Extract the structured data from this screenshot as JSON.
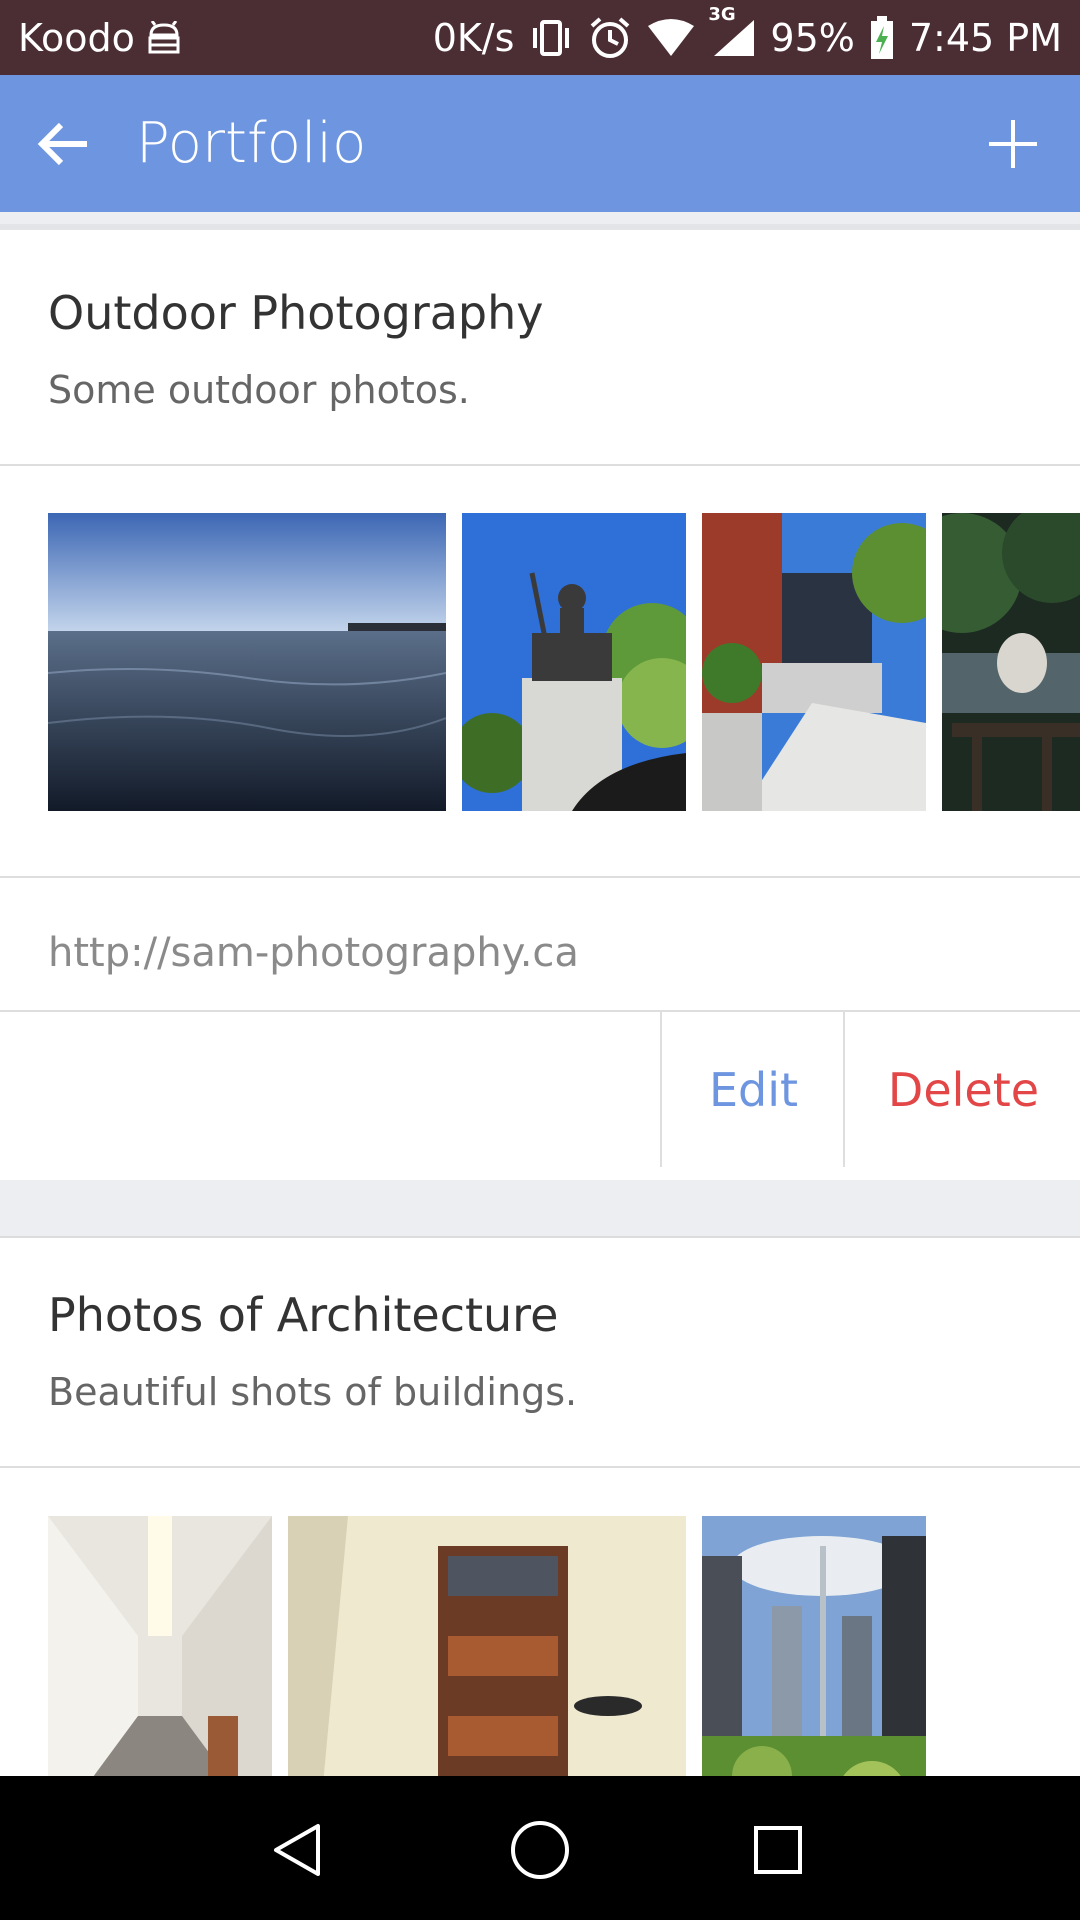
{
  "status_bar": {
    "carrier": "Koodo",
    "speed": "0K/s",
    "network_type": "3G",
    "battery": "95%",
    "time": "7:45 PM",
    "icons": [
      "android-icon",
      "vibrate-icon",
      "alarm-icon",
      "wifi-icon",
      "signal-icon",
      "battery-charging-icon"
    ]
  },
  "app_bar": {
    "title": "Portfolio",
    "back_icon": "arrow-left-icon",
    "add_icon": "plus-icon",
    "color": "#6e96e0"
  },
  "portfolios": [
    {
      "title": "Outdoor Photography",
      "description": "Some outdoor photos.",
      "photos": [
        "lake-water-photo",
        "statue-photo",
        "brick-building-stairs-photo",
        "park-bench-photo"
      ],
      "link": "http://sam-photography.ca",
      "edit_label": "Edit",
      "delete_label": "Delete"
    },
    {
      "title": "Photos of Architecture",
      "description": "Beautiful shots of buildings.",
      "photos": [
        "hallway-photo",
        "atrium-photo",
        "city-skyline-photo"
      ]
    }
  ],
  "colors": {
    "accent": "#6e96e0",
    "delete": "#e24646",
    "status_bar": "#4b2d34"
  },
  "nav_bar": {
    "icons": [
      "back-triangle-icon",
      "home-circle-icon",
      "recents-square-icon"
    ]
  }
}
